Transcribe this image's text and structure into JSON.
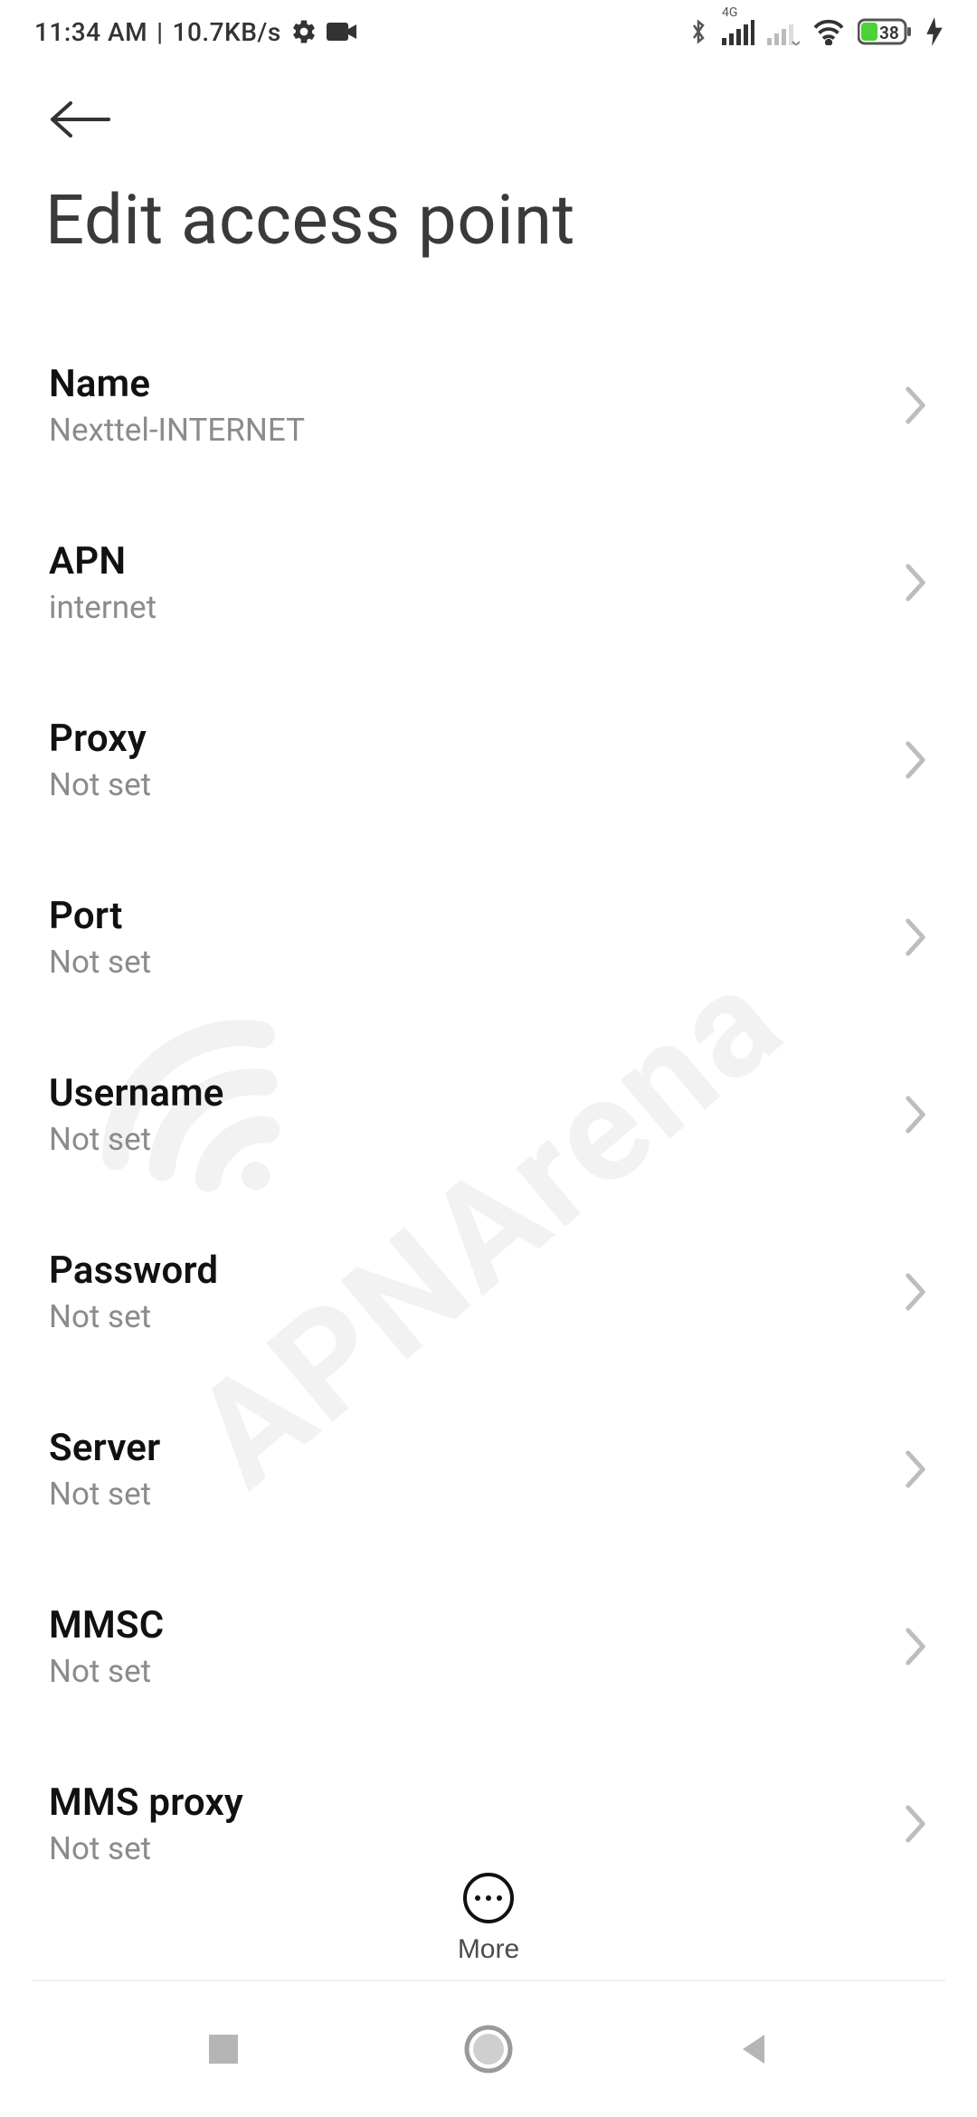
{
  "status": {
    "time": "11:34 AM",
    "net_speed": "10.7KB/s",
    "battery_pct": "38",
    "network_label": "4G"
  },
  "page_title": "Edit access point",
  "settings": [
    {
      "label": "Name",
      "value": "Nexttel-INTERNET"
    },
    {
      "label": "APN",
      "value": "internet"
    },
    {
      "label": "Proxy",
      "value": "Not set"
    },
    {
      "label": "Port",
      "value": "Not set"
    },
    {
      "label": "Username",
      "value": "Not set"
    },
    {
      "label": "Password",
      "value": "Not set"
    },
    {
      "label": "Server",
      "value": "Not set"
    },
    {
      "label": "MMSC",
      "value": "Not set"
    },
    {
      "label": "MMS proxy",
      "value": "Not set"
    }
  ],
  "more_label": "More",
  "watermark_text": "APNArena"
}
